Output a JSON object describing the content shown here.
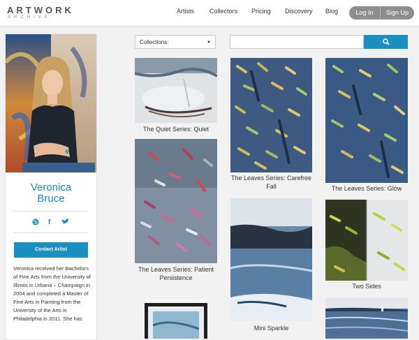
{
  "logo": {
    "name": "ARTWORK",
    "sub": "ARCHIVE"
  },
  "nav": {
    "items": [
      "Artists",
      "Collectors",
      "Pricing",
      "Discovery",
      "Blog"
    ],
    "login_label": "Log In",
    "signup_label": "Sign Up"
  },
  "artist": {
    "first_name": "Veronica",
    "last_name": "Bruce",
    "contact_label": "Contact Artist",
    "bio": "Veronica received her Bachelors of Fine Arts from the University of Illinois in Urbana – Champaign in 2004 and completed a Master of Fine Arts in Painting from the University of the Arts in Philadelphia in 2011. She has",
    "social_icons": [
      "globe-icon",
      "facebook-icon",
      "twitter-icon"
    ]
  },
  "toolbar": {
    "collections_selected": "Collections:",
    "search_placeholder": ""
  },
  "artworks": [
    {
      "title": "The Quiet Series: Quiet"
    },
    {
      "title": "The Leaves Series: Patient Persistence"
    },
    {
      "title": "The Leaves Series: Carefree Fall"
    },
    {
      "title": "Mini Sparkle"
    },
    {
      "title": "The Leaves Series: Glow"
    },
    {
      "title": "Two Sides"
    }
  ],
  "colors": {
    "accent": "#1a8fc1",
    "button_gray": "#8e8e8e"
  }
}
